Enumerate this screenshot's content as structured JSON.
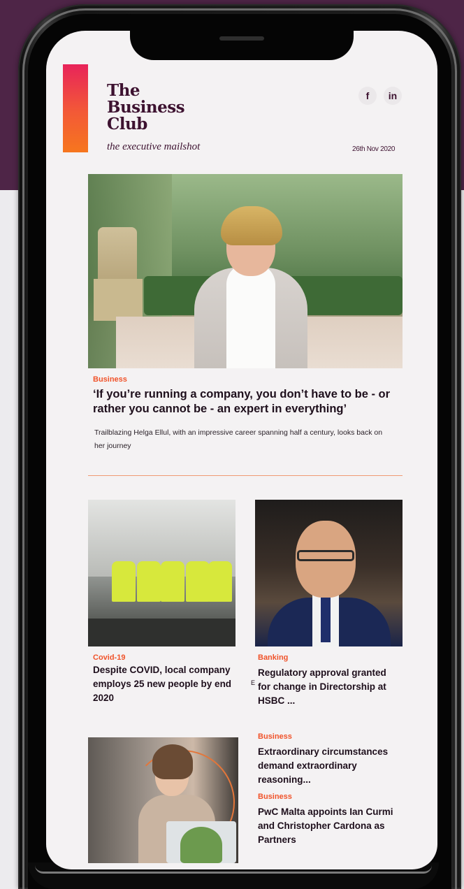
{
  "brand": {
    "logo_lines": [
      "The",
      "Business",
      "Club"
    ],
    "tagline": "the executive mailshot",
    "date": "26th Nov 2020",
    "social": {
      "facebook": "f",
      "linkedin": "in"
    }
  },
  "hero": {
    "category": "Business",
    "title": "‘If you’re running a company, you don’t have to be - or rather you cannot be - an expert in everything’",
    "summary": "Trailblazing Helga Ellul, with an impressive career spanning half a century, looks back on her journey"
  },
  "articles": [
    {
      "category": "Covid-19",
      "title": "Despite COVID, local company employs 25 new people by end 2020"
    },
    {
      "category": "Banking",
      "title": "Regulatory approval granted for change in Directorship at HSBC ...",
      "stray_char": "E"
    },
    {
      "category": "Business",
      "title": "Extraordinary circumstances demand extraordinary reasoning..."
    },
    {
      "category": "Business",
      "title": "PwC Malta appoints Ian Curmi and Christopher Cardona as Partners"
    }
  ],
  "colors": {
    "accent": "#f0532a",
    "brand_text": "#3d1230",
    "background_top": "#4e2547"
  }
}
